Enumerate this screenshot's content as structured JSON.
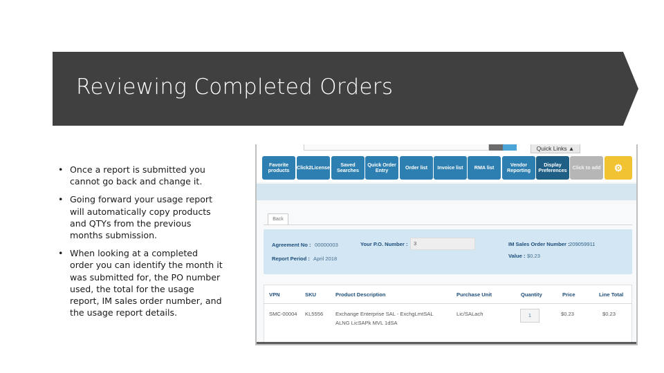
{
  "slide": {
    "title": "Reviewing Completed Orders",
    "bullets": [
      "Once a report is submitted you cannot go back and change it.",
      "Going forward your usage report will automatically copy products and QTYs from the previous months submission.",
      "When looking at a completed order you can identify the month it was submitted for, the PO number used, the total for the usage report, IM sales order number, and the usage report details."
    ],
    "bullet_glyph": "•"
  },
  "screenshot": {
    "quick_links_tab": "Quick Links ▲",
    "quick_links": [
      {
        "label": "Favorite products",
        "style": "blue"
      },
      {
        "label": "Click2License",
        "style": "blue"
      },
      {
        "label": "Saved Searches",
        "style": "blue"
      },
      {
        "label": "Quick Order Entry",
        "style": "blue"
      },
      {
        "label": "Order list",
        "style": "blue"
      },
      {
        "label": "Invoice list",
        "style": "blue"
      },
      {
        "label": "RMA list",
        "style": "blue"
      },
      {
        "label": "Vendor Reporting",
        "style": "blue"
      },
      {
        "label": "Display Preferences",
        "style": "dark"
      },
      {
        "label": "Click to add",
        "style": "grey"
      },
      {
        "label": "⚙",
        "style": "gold",
        "icon": "gear-icon"
      }
    ],
    "back_button": "Back",
    "order_info": {
      "agreement_label": "Agreement No :",
      "agreement_value": "00000003",
      "po_label": "Your P.O. Number :",
      "po_value": "3",
      "report_period_label": "Report Period :",
      "report_period_value": "April 2018",
      "im_sales_order_label": "IM Sales Order Number :",
      "im_sales_order_value": "209059911",
      "value_label": "Value :",
      "value_value": "$0.23"
    },
    "table": {
      "headers": [
        "VPN",
        "SKU",
        "Product Description",
        "Purchase Unit",
        "Quantity",
        "Price",
        "Line Total"
      ],
      "rows": [
        {
          "vpn": "SMC-00004",
          "sku": "KL5556",
          "description_line1": "Exchange Enterprise SAL - ExchgLmtSAL",
          "description_line2": "ALNG LicSAPk MVL 1dSA",
          "purchase_unit": "Lic/SALach",
          "quantity": "1",
          "price": "$0.23",
          "line_total": "$0.23"
        }
      ]
    }
  }
}
